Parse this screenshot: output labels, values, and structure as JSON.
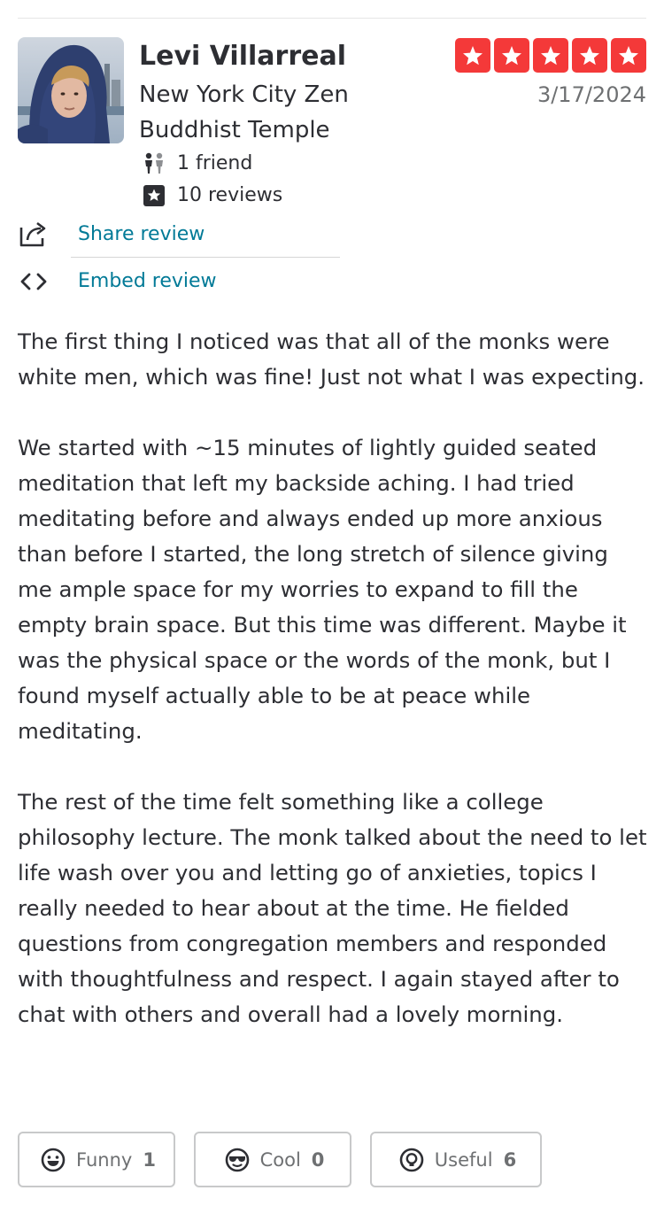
{
  "reviewer": {
    "name": "Levi Villarreal",
    "avatar_icon": "user-avatar-photo",
    "friends": "1 friend",
    "reviews": "10 reviews"
  },
  "business": {
    "name": "New York City Zen Buddhist Temple"
  },
  "rating": {
    "stars": 5,
    "max": 5,
    "color": "#f43939"
  },
  "date": "3/17/2024",
  "actions": {
    "share_label": "Share review",
    "embed_label": "Embed review",
    "link_color": "#027a97"
  },
  "review": {
    "paragraphs": [
      "The first thing I noticed was that all of the monks were white men, which was fine! Just not what I was expecting.",
      "We started with ~15 minutes of lightly guided seated meditation that left my backside aching. I had tried meditating before and always ended up more anxious than before I started, the long stretch of silence giving me ample space for my worries to expand to fill the empty brain space. But this time was different. Maybe it was the physical space or the words of the monk, but I found myself actually able to be at peace while meditating.",
      "The rest of the time felt something like a college philosophy lecture. The monk talked about the need to let life wash over you and letting go of anxieties, topics I really needed to hear about at the time. He fielded questions from congregation members and responded with thoughtfulness and respect. I again stayed after to chat with others and overall had a lovely morning."
    ]
  },
  "reactions": {
    "funny": {
      "label": "Funny",
      "count": "1",
      "icon": "funny-face-icon"
    },
    "cool": {
      "label": "Cool",
      "count": "0",
      "icon": "sunglasses-face-icon"
    },
    "useful": {
      "label": "Useful",
      "count": "6",
      "icon": "lightbulb-icon"
    }
  }
}
